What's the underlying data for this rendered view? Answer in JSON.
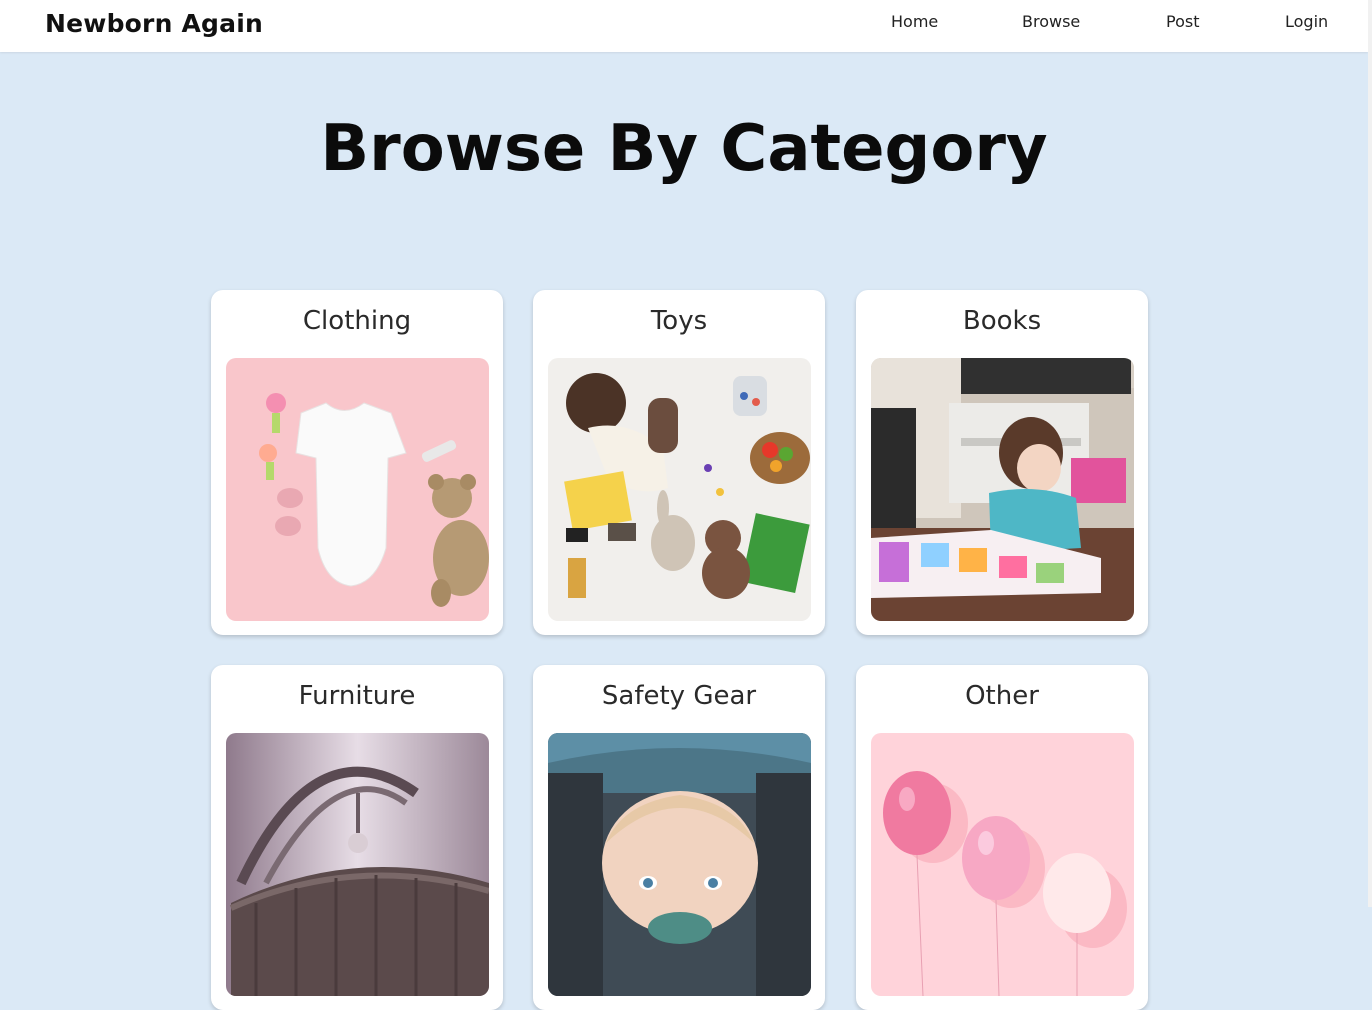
{
  "brand": "Newborn Again",
  "nav": {
    "home": "Home",
    "browse": "Browse",
    "post": "Post",
    "login": "Login"
  },
  "page_title": "Browse By Category",
  "categories": [
    {
      "label": "Clothing"
    },
    {
      "label": "Toys"
    },
    {
      "label": "Books"
    },
    {
      "label": "Furniture"
    },
    {
      "label": "Safety Gear"
    },
    {
      "label": "Other"
    }
  ],
  "colors": {
    "page_background": "#dbe9f6",
    "navbar_background": "#ffffff",
    "card_background": "#ffffff",
    "clothing_photo_bg": "#f9c6cb",
    "other_photo_bg": "#ffd3da"
  }
}
